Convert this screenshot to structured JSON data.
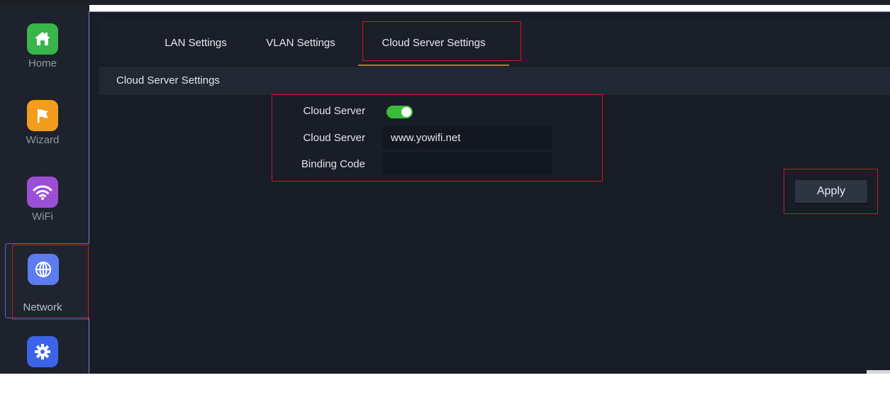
{
  "sidebar": {
    "items": [
      {
        "label": "Home",
        "icon": "home-icon",
        "color": "#39b54a"
      },
      {
        "label": "Wizard",
        "icon": "flag-icon",
        "color": "#f39c1d"
      },
      {
        "label": "WiFi",
        "icon": "wifi-icon",
        "color": "#9b4fd6"
      },
      {
        "label": "Network",
        "icon": "globe-icon",
        "color": "#5c7cf0",
        "active": true
      },
      {
        "label": "",
        "icon": "gear-icon",
        "color": "#3c63e8"
      }
    ]
  },
  "tabs": [
    {
      "label": "LAN Settings"
    },
    {
      "label": "VLAN Settings"
    },
    {
      "label": "Cloud Server Settings",
      "active": true
    }
  ],
  "section": {
    "title": "Cloud Server Settings"
  },
  "form": {
    "cloud_server_toggle_label": "Cloud Server",
    "cloud_server_enabled": true,
    "cloud_server_address_label": "Cloud Server",
    "cloud_server_address_value": "www.yowifi.net",
    "binding_code_label": "Binding Code",
    "binding_code_value": ""
  },
  "actions": {
    "apply_label": "Apply"
  },
  "colors": {
    "accent_tab_underline": "#a97b3a",
    "highlight_box": "#d0181b",
    "toggle_on": "#3cbb3a"
  }
}
